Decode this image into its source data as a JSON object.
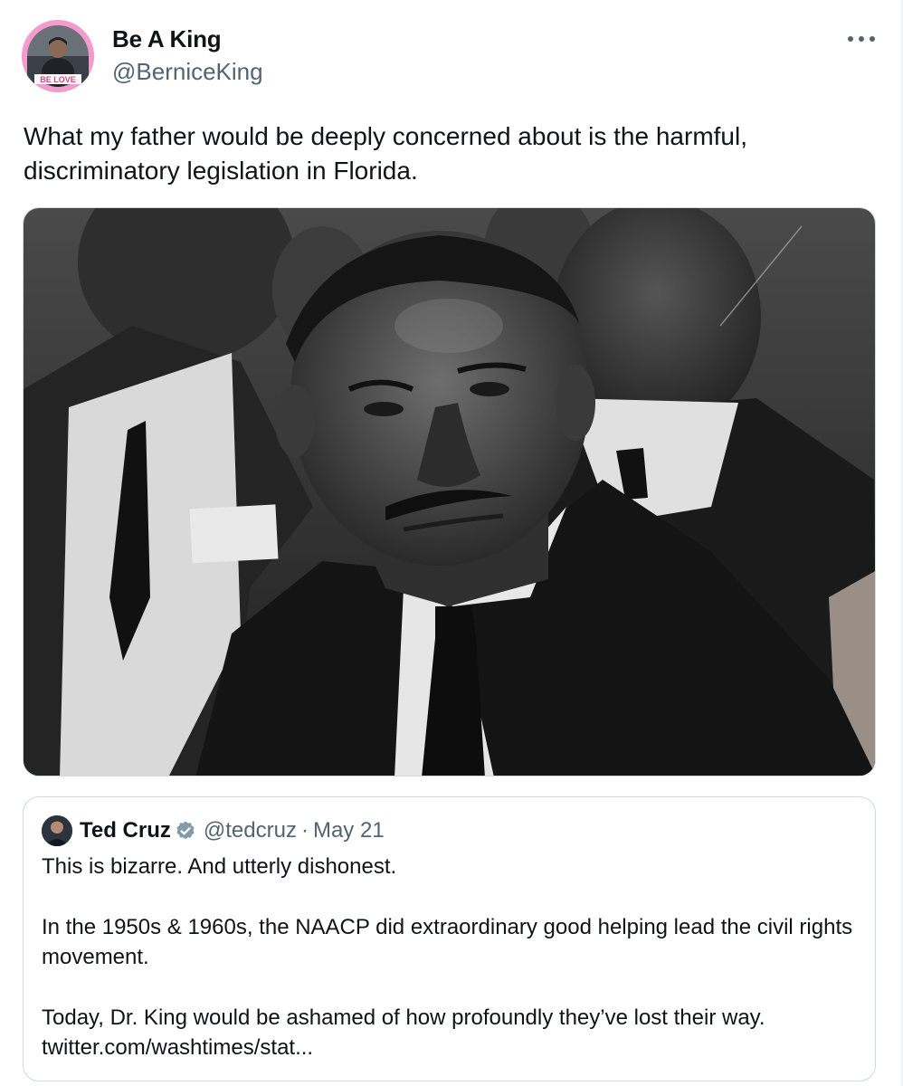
{
  "author": {
    "name": "Be A King",
    "handle": "@BerniceKing",
    "avatar_badge": "BE LOVE",
    "avatar_border_color": "#f39bcd"
  },
  "tweet": {
    "text": "What my father would be deeply concerned about is the harmful, discriminatory legislation in Florida."
  },
  "media": {
    "kind": "black-and-white photograph",
    "accent_colors": [
      "#1a1a1a",
      "#8a8a8a",
      "#e6e6e6"
    ]
  },
  "more_icon": "more-horizontal-icon",
  "quoted": {
    "name": "Ted Cruz",
    "verified_icon": "verified-badge-icon",
    "verified_color": "#829aab",
    "handle": "@tedcruz",
    "separator": "·",
    "date": "May 21",
    "para1": "This is bizarre. And utterly dishonest.",
    "para2": "In the 1950s & 1960s, the NAACP did extraordinary good helping lead the civil rights movement.",
    "para3": "Today, Dr. King would be ashamed of how profoundly they’ve lost their way.",
    "link": "twitter.com/washtimes/stat..."
  }
}
